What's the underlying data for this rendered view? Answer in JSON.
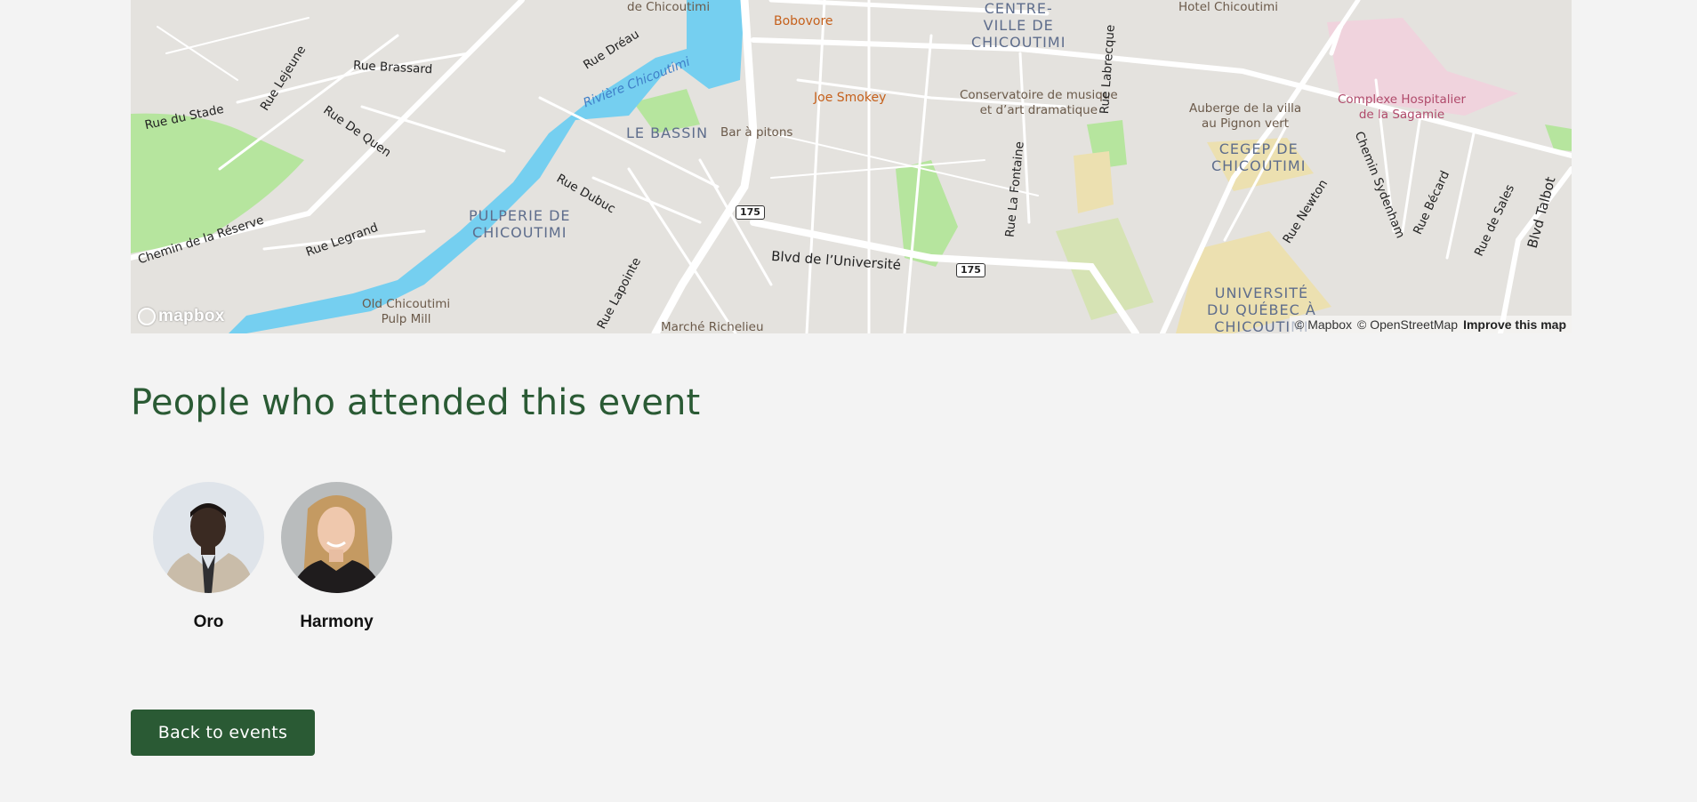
{
  "map": {
    "labels": {
      "centre_ville": "CENTRE-\nVILLE DE\nCHICOUTIMI",
      "le_bassin": "LE BASSIN",
      "pulperie": "PULPERIE DE\nCHICOUTIMI",
      "cegep": "CEGEP DE\nCHICOUTIMI",
      "uqac": "UNIVERSITÉ\nDU QUÉBEC À\nCHICOUTIMI",
      "de_chicoutimi": "de Chicoutimi",
      "bobovore": "Bobovore",
      "joe_smokey": "Joe Smokey",
      "bar_pitons": "Bar à pitons",
      "conservatoire": "Conservatoire de musique\net d’art dramatique",
      "hotel": "Hotel Chicoutimi",
      "auberge": "Auberge de la villa\nau Pignon vert",
      "complexe": "Complexe Hospitalier\nde la Sagamie",
      "old_pulp": "Old Chicoutimi\nPulp Mill",
      "marche": "Marché Richelieu",
      "riviere": "Rivière Chicoutimi",
      "rue_brassard": "Rue Brassard",
      "rue_du_stade": "Rue du Stade",
      "rue_lejeune": "Rue Lejeune",
      "rue_de_quen": "Rue De Quen",
      "rue_dreau": "Rue Dréau",
      "rue_dubuc": "Rue Dubuc",
      "rue_legrand": "Rue Legrand",
      "chemin_reserve": "Chemin de la Réserve",
      "rue_lapointe": "Rue Lapointe",
      "blvd_universite": "Blvd de l’Université",
      "rue_lafontaine": "Rue La Fontaine",
      "rue_labrecque": "Rue Labrecque",
      "rue_newton": "Rue Newton",
      "chemin_sydenham": "Chemin Sydenham",
      "rue_becard": "Rue Bécard",
      "rue_de_sales": "Rue de Sales",
      "blvd_talbot": "Blvd Talbot",
      "route_175": "175"
    },
    "logo": "mapbox",
    "attribution": {
      "mapbox": "© Mapbox",
      "osm": "© OpenStreetMap",
      "improve": "Improve this map"
    },
    "colors": {
      "water": "#75cff0",
      "park": "#b6e59e",
      "land": "#e4e2de",
      "campus": "#ece0b0",
      "hospital": "#f0d3dd"
    }
  },
  "section": {
    "title": "People who attended this event"
  },
  "attendees": [
    {
      "name": "Oro",
      "avatar": "man-in-beige-suit-photo"
    },
    {
      "name": "Harmony",
      "avatar": "smiling-woman-photo"
    }
  ],
  "actions": {
    "back_label": "Back to events"
  },
  "colors": {
    "accent": "#2a5a34",
    "background": "#f3f3f3"
  }
}
